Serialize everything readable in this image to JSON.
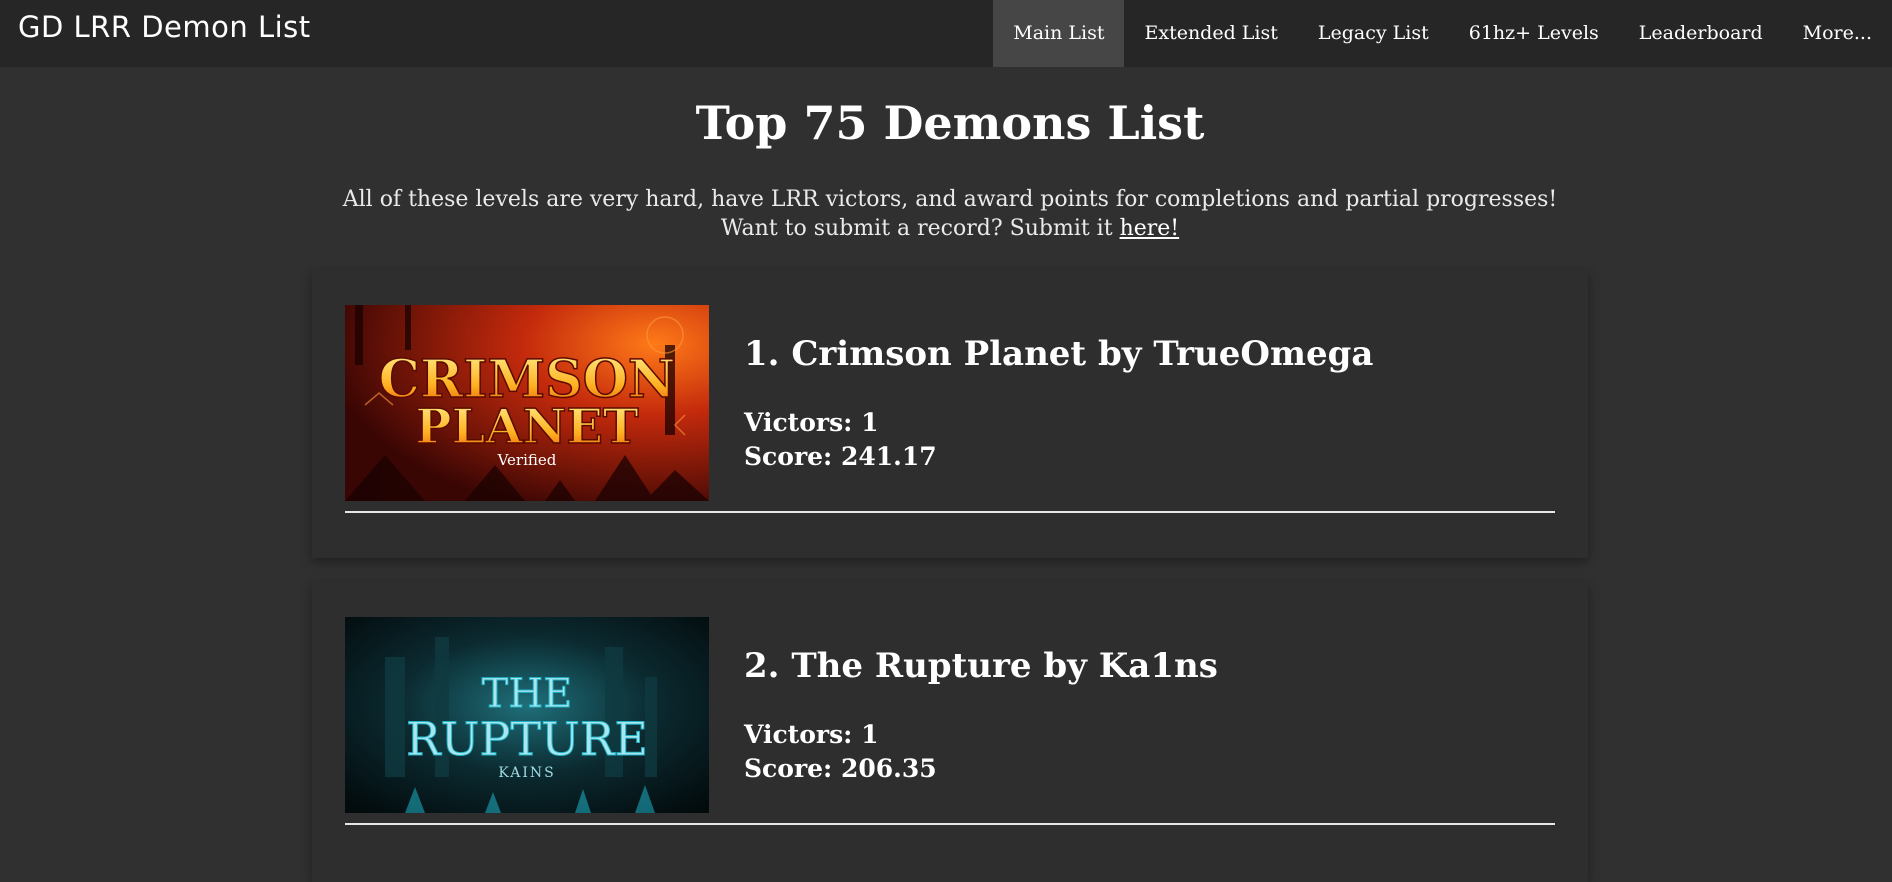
{
  "navbar": {
    "brand": "GD LRR Demon List",
    "links": [
      {
        "label": "Main List",
        "active": true
      },
      {
        "label": "Extended List",
        "active": false
      },
      {
        "label": "Legacy List",
        "active": false
      },
      {
        "label": "61hz+ Levels",
        "active": false
      },
      {
        "label": "Leaderboard",
        "active": false
      },
      {
        "label": "More...",
        "active": false
      }
    ]
  },
  "page": {
    "title": "Top 75 Demons List",
    "intro_line1": "All of these levels are very hard, have LRR victors, and award points for completions and partial progresses!",
    "intro_line2_prefix": "Want to submit a record? Submit it ",
    "intro_link": "here!"
  },
  "levels": [
    {
      "title": "1. Crimson Planet by TrueOmega",
      "victors_label": "Victors:",
      "victors": "1",
      "score_label": "Score:",
      "score": "241.17",
      "thumbnail": {
        "line1": "CRIMSON",
        "line2": "PLANET",
        "caption": "Verified",
        "colors": {
          "bg": "#7a1208",
          "accent": "#ff6a10",
          "text": "#ffcf33"
        }
      }
    },
    {
      "title": "2. The Rupture by Ka1ns",
      "victors_label": "Victors:",
      "victors": "1",
      "score_label": "Score:",
      "score": "206.35",
      "thumbnail": {
        "line1": "THE",
        "line2": "RUPTURE",
        "caption": "KAINS",
        "colors": {
          "bg": "#06181c",
          "accent": "#1fb3c7",
          "text": "#a9e6ee"
        }
      }
    }
  ]
}
